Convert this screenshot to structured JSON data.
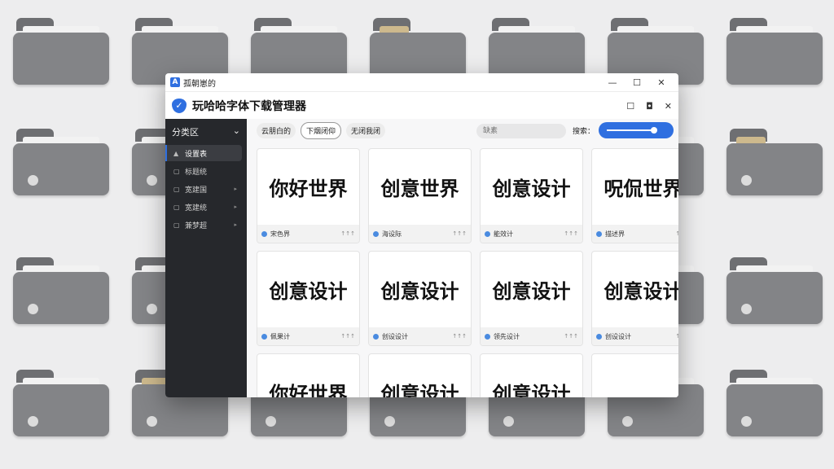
{
  "window": {
    "title": "孤朝崽的",
    "app_title": "玩哈哈字体下载管理器",
    "controls": [
      "—",
      "☐",
      "✕"
    ],
    "app_icons": [
      "☐",
      "◘",
      "✕"
    ]
  },
  "sidebar": {
    "header": "分类区",
    "items": [
      {
        "label": "设置表"
      },
      {
        "label": "标题统"
      },
      {
        "label": "宽建国"
      },
      {
        "label": "宽建统"
      },
      {
        "label": "兼梦超"
      }
    ]
  },
  "toolbar": {
    "buttons": [
      "云朋白的",
      "下烟闭仰",
      "无闭我闭"
    ],
    "search_placeholder": "缺素",
    "search_label": "搜索："
  },
  "cards": [
    {
      "preview": "你好世界",
      "name": "宋色界",
      "meta": "↑↑↑"
    },
    {
      "preview": "创意世界",
      "name": "海设际",
      "meta": "↑↑↑"
    },
    {
      "preview": "创意设计",
      "name": "能效计",
      "meta": "↑↑↑"
    },
    {
      "preview": "呪侃世界",
      "name": "描述界",
      "meta": "↑↑↑"
    },
    {
      "preview": "创意设计",
      "name": "佩果计",
      "meta": "↑↑↑"
    },
    {
      "preview": "创意设计",
      "name": "创设设计",
      "meta": "↑↑↑"
    },
    {
      "preview": "创意设计",
      "name": "领先设计",
      "meta": "↑↑↑"
    },
    {
      "preview": "创意设计",
      "name": "创设设计",
      "meta": "↑↑↑"
    },
    {
      "preview": "你好世界",
      "name": "",
      "meta": ""
    },
    {
      "preview": "创意设计",
      "name": "",
      "meta": ""
    },
    {
      "preview": "创意设计",
      "name": "",
      "meta": ""
    },
    {
      "preview": "",
      "name": "",
      "meta": ""
    }
  ]
}
